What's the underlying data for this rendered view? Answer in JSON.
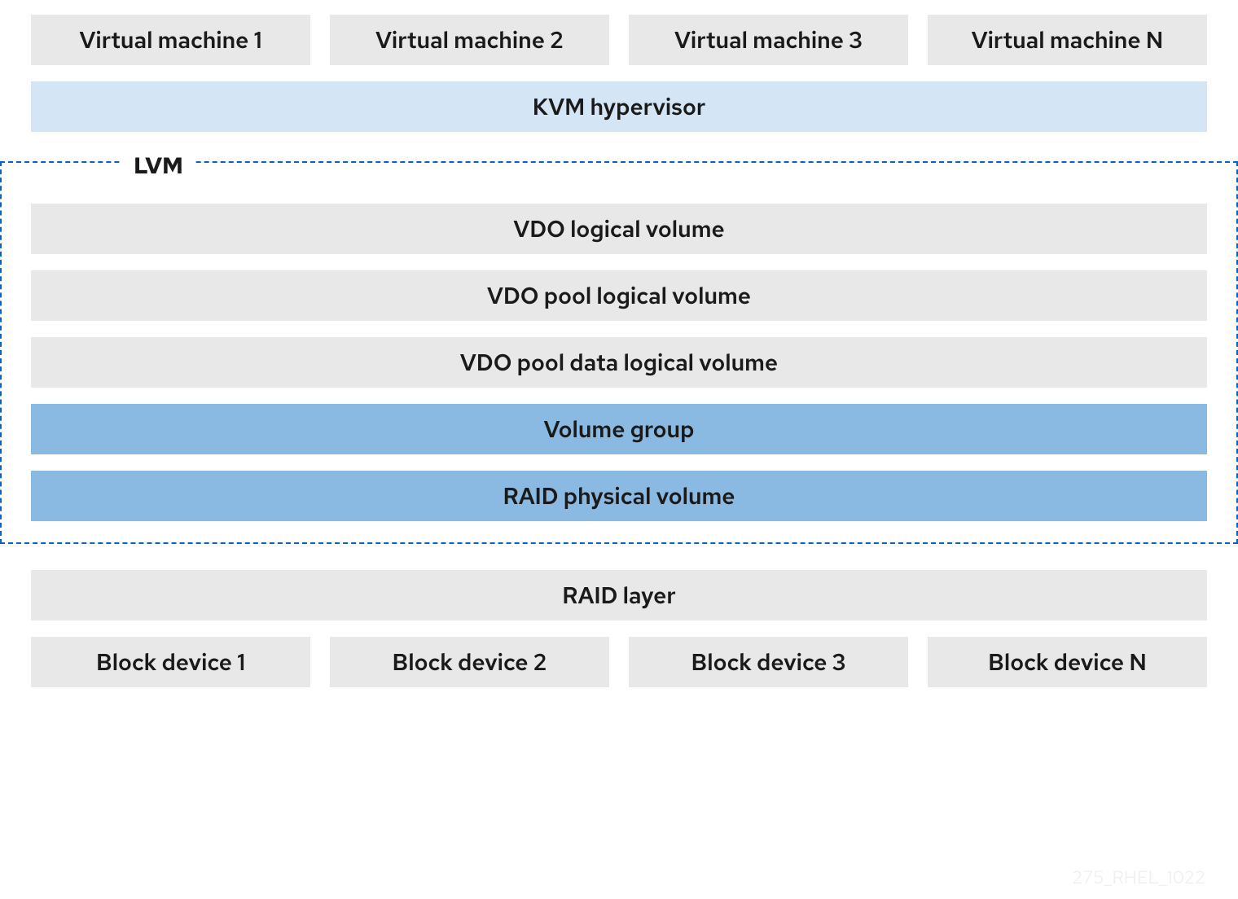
{
  "vms": [
    "Virtual machine 1",
    "Virtual machine 2",
    "Virtual machine 3",
    "Virtual machine N"
  ],
  "hypervisor": "KVM hypervisor",
  "lvm": {
    "legend": "LVM",
    "layers": [
      {
        "label": "VDO logical volume",
        "style": "gray"
      },
      {
        "label": "VDO pool logical volume",
        "style": "gray"
      },
      {
        "label": "VDO pool data logical volume",
        "style": "gray"
      },
      {
        "label": "Volume group",
        "style": "blue"
      },
      {
        "label": "RAID physical volume",
        "style": "blue"
      }
    ]
  },
  "raid_layer": "RAID layer",
  "block_devices": [
    "Block device 1",
    "Block device 2",
    "Block device 3",
    "Block device N"
  ],
  "watermark": "275_RHEL_1022"
}
